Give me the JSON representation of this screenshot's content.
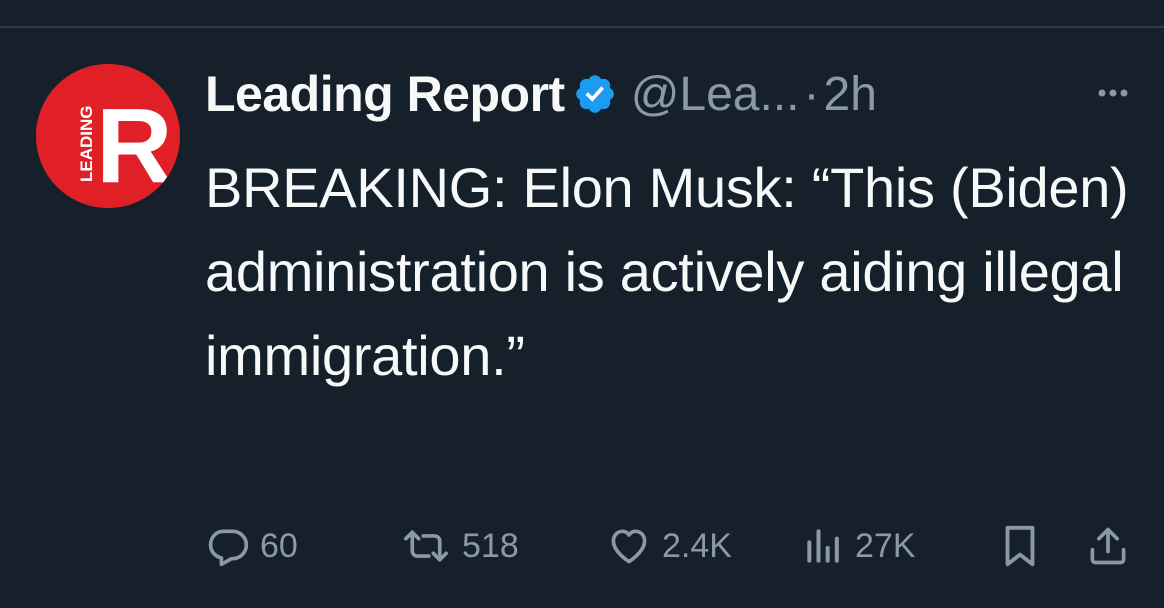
{
  "tweet": {
    "display_name": "Leading Report",
    "handle": "@Lea...",
    "separator": "·",
    "time": "2h",
    "text": "BREAKING: Elon Musk: “This (Biden) administration is actively aiding illegal immigration.”",
    "avatar": {
      "side_text": "LEADING",
      "letter": "R",
      "color": "#e02026"
    }
  },
  "actions": {
    "replies": "60",
    "retweets": "518",
    "likes": "2.4K",
    "views": "27K"
  },
  "colors": {
    "background": "#15202b",
    "text": "#f7f9f9",
    "muted": "#8b98a5",
    "verified": "#1d9bf0"
  },
  "icons": {
    "verified": "verified-badge-icon",
    "more": "more-dots-icon",
    "reply": "reply-icon",
    "retweet": "retweet-icon",
    "like": "heart-icon",
    "views": "views-chart-icon",
    "bookmark": "bookmark-icon",
    "share": "share-icon"
  }
}
